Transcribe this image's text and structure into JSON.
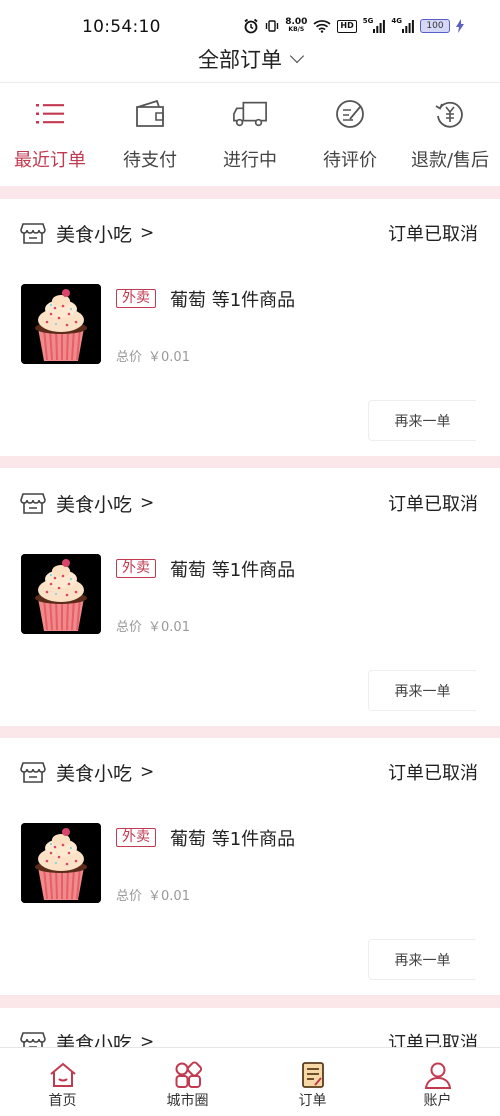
{
  "status_bar": {
    "time": "10:54:10",
    "net_speed": "8.00",
    "net_speed_unit": "KB/S",
    "hd": "HD",
    "signal_5g": "5G",
    "signal_4g": "4G",
    "battery": "100"
  },
  "header": {
    "title": "全部订单"
  },
  "tabs": [
    {
      "label": "最近订单",
      "icon": "list-icon",
      "active": true
    },
    {
      "label": "待支付",
      "icon": "wallet-icon",
      "active": false
    },
    {
      "label": "进行中",
      "icon": "truck-icon",
      "active": false
    },
    {
      "label": "待评价",
      "icon": "review-icon",
      "active": false
    },
    {
      "label": "退款/售后",
      "icon": "refund-icon",
      "active": false
    }
  ],
  "orders": [
    {
      "shop": "美食小吃",
      "arrow": ">",
      "status": "订单已取消",
      "tag": "外卖",
      "title": "葡萄 等1件商品",
      "price_label": "总价",
      "price": "￥0.01",
      "action": "再来一单"
    },
    {
      "shop": "美食小吃",
      "arrow": ">",
      "status": "订单已取消",
      "tag": "外卖",
      "title": "葡萄 等1件商品",
      "price_label": "总价",
      "price": "￥0.01",
      "action": "再来一单"
    },
    {
      "shop": "美食小吃",
      "arrow": ">",
      "status": "订单已取消",
      "tag": "外卖",
      "title": "葡萄 等1件商品",
      "price_label": "总价",
      "price": "￥0.01",
      "action": "再来一单"
    },
    {
      "shop": "美食小吃",
      "arrow": ">",
      "status": "订单已取消"
    }
  ],
  "bottom_nav": [
    {
      "label": "首页",
      "icon": "home-icon"
    },
    {
      "label": "城市圈",
      "icon": "city-circle-icon"
    },
    {
      "label": "订单",
      "icon": "order-icon"
    },
    {
      "label": "账户",
      "icon": "account-icon"
    }
  ],
  "colors": {
    "accent": "#c23a50",
    "band": "#fbe6e9"
  }
}
